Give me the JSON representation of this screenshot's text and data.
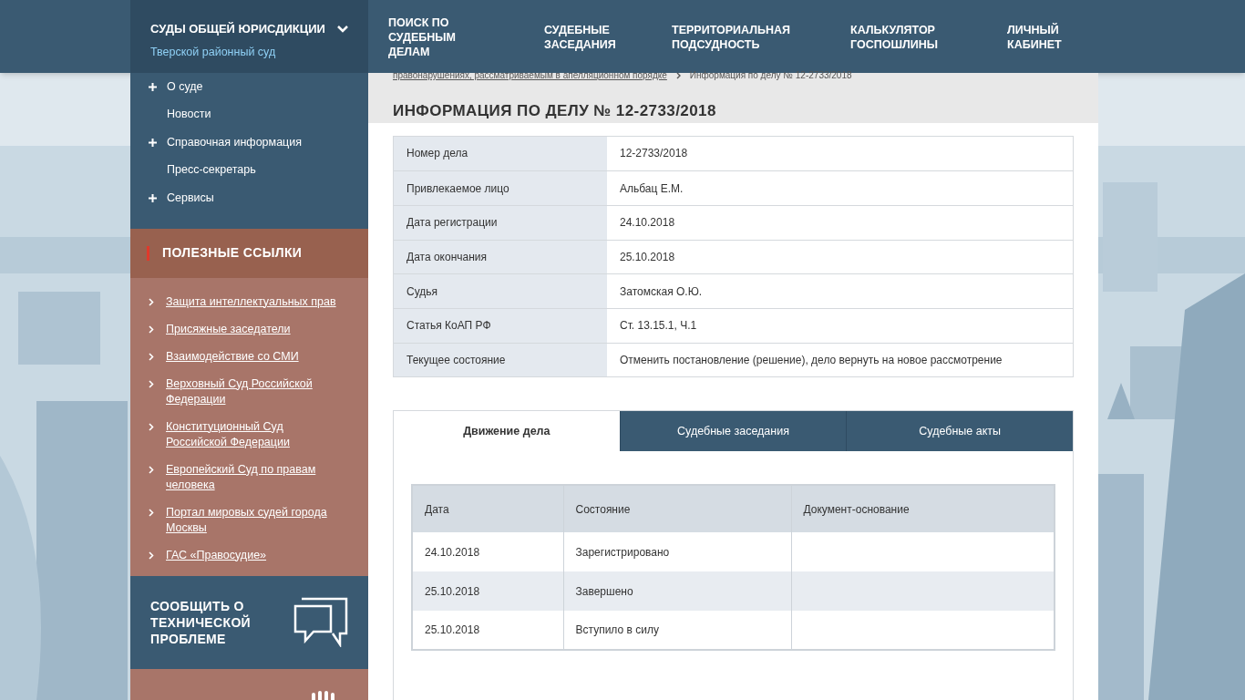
{
  "header": {
    "section": {
      "title": "СУДЫ ОБЩЕЙ ЮРИСДИКЦИИ",
      "subtitle": "Тверской районный суд",
      "expanded": false
    },
    "nav": [
      "ПОИСК ПО СУДЕБНЫМ ДЕЛАМ",
      "СУДЕБНЫЕ ЗАСЕДАНИЯ",
      "ТЕРРИТОРИАЛЬНАЯ ПОДСУДНОСТЬ",
      "КАЛЬКУЛЯТОР ГОСПОШЛИНЫ",
      "ЛИЧНЫЙ КАБИНЕТ"
    ]
  },
  "sidebar": {
    "menu": [
      {
        "label": "О суде",
        "expandable": true
      },
      {
        "label": "Новости",
        "expandable": false
      },
      {
        "label": "Справочная информация",
        "expandable": true
      },
      {
        "label": "Пресс-секретарь",
        "expandable": false
      },
      {
        "label": "Сервисы",
        "expandable": true
      }
    ],
    "links_title": "ПОЛЕЗНЫЕ ССЫЛКИ",
    "links": [
      "Защита интеллектуальных прав",
      "Присяжные заседатели",
      "Взаимодействие со СМИ",
      "Верховный Суд Российской Федерации",
      "Конституционный Суд Российской Федерации",
      "Европейский Суд по правам человека",
      "Портал мировых судей города Москвы",
      "ГАС «Правосудие»"
    ],
    "report": "СООБЩИТЬ О ТЕХНИЧЕСКОЙ ПРОБЛЕМЕ"
  },
  "breadcrumb": [
    {
      "label": "правонарушениях, рассматриваемым в апелляционном порядке",
      "link": true
    },
    {
      "label": "Информация по делу № 12-2733/2018",
      "link": false
    }
  ],
  "title": "ИНФОРМАЦИЯ ПО ДЕЛУ № 12-2733/2018",
  "case_info": [
    {
      "label": "Номер дела",
      "value": "12-2733/2018"
    },
    {
      "label": "Привлекаемое лицо",
      "value": "Альбац Е.М."
    },
    {
      "label": "Дата регистрации",
      "value": "24.10.2018"
    },
    {
      "label": "Дата окончания",
      "value": "25.10.2018"
    },
    {
      "label": "Судья",
      "value": "Затомская О.Ю."
    },
    {
      "label": "Статья КоАП РФ",
      "value": "Ст. 13.15.1, Ч.1"
    },
    {
      "label": "Текущее состояние",
      "value": "Отменить постановление (решение), дело вернуть на новое рассмотрение"
    }
  ],
  "tabs": [
    {
      "label": "Движение дела",
      "selected": true
    },
    {
      "label": "Судебные заседания",
      "selected": false
    },
    {
      "label": "Судебные акты",
      "selected": false
    }
  ],
  "events": {
    "columns": [
      "Дата",
      "Состояние",
      "Документ-основание"
    ],
    "rows": [
      [
        "24.10.2018",
        "Зарегистрировано",
        ""
      ],
      [
        "25.10.2018",
        "Завершено",
        ""
      ],
      [
        "25.10.2018",
        "Вступило в силу",
        ""
      ]
    ]
  }
}
